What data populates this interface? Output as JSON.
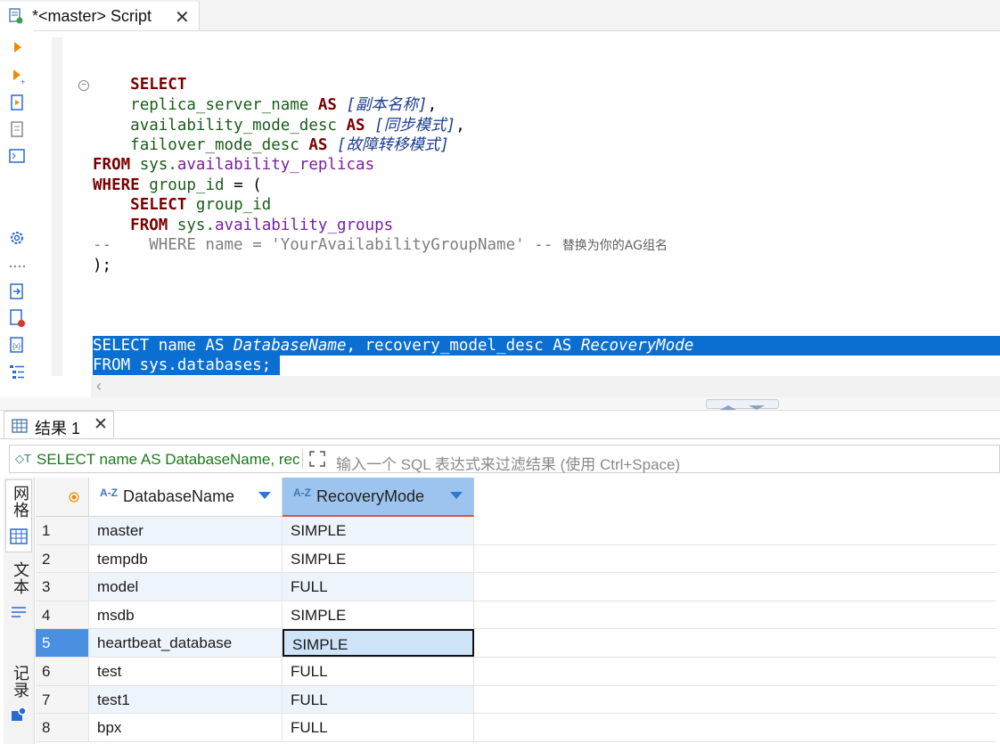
{
  "editor_tab": {
    "title": "*<master> Script",
    "close": "✕"
  },
  "results_tab": {
    "label": "结果 1",
    "close": "✕"
  },
  "code": {
    "l1_kw": "SELECT",
    "l2_id": "replica_server_name",
    "l2_as": "AS",
    "l2_alias": "[副本名称]",
    "l2_tail": ",",
    "l3_id": "availability_mode_desc",
    "l3_as": "AS",
    "l3_alias": "[同步模式]",
    "l3_tail": ",",
    "l4_id": "failover_mode_desc",
    "l4_as": "AS",
    "l4_alias": "[故障转移模式]",
    "l5_kw": "FROM",
    "l5_schema": "sys.",
    "l5_obj": "availability_replicas",
    "l6_kw": "WHERE",
    "l6_id": "group_id",
    "l6_op": " = (",
    "l7_kw": "SELECT",
    "l7_id": "group_id",
    "l8_kw": "FROM",
    "l8_schema": "sys.",
    "l8_obj": "availability_groups",
    "l9_comment": "--    WHERE name = 'YourAvailabilityGroupName' --",
    "l9_zh": "替换为你的AG组名",
    "l10": ");",
    "s1_a": "SELECT name AS ",
    "s1_b": "DatabaseName",
    "s1_c": ", recovery_model_desc AS ",
    "s1_d": "RecoveryMode",
    "s2": "FROM sys.databases;"
  },
  "filter": {
    "query": "SELECT name AS DatabaseName, rec",
    "placeholder": "输入一个 SQL 表达式来过滤结果 (使用 Ctrl+Space)"
  },
  "side_tabs": {
    "grid": "网格",
    "text": "文本",
    "record": "记录"
  },
  "grid": {
    "columns": [
      "DatabaseName",
      "RecoveryMode"
    ],
    "rows": [
      [
        "1",
        "master",
        "SIMPLE"
      ],
      [
        "2",
        "tempdb",
        "SIMPLE"
      ],
      [
        "3",
        "model",
        "FULL"
      ],
      [
        "4",
        "msdb",
        "SIMPLE"
      ],
      [
        "5",
        "heartbeat_database",
        "SIMPLE"
      ],
      [
        "6",
        "test",
        "FULL"
      ],
      [
        "7",
        "test1",
        "FULL"
      ],
      [
        "8",
        "bpx",
        "FULL"
      ]
    ],
    "selected_row": 5
  },
  "colors": {
    "selection": "#0b6fd1",
    "row_alt": "#eef4fc",
    "selected_cell": "#cfe3f9"
  }
}
